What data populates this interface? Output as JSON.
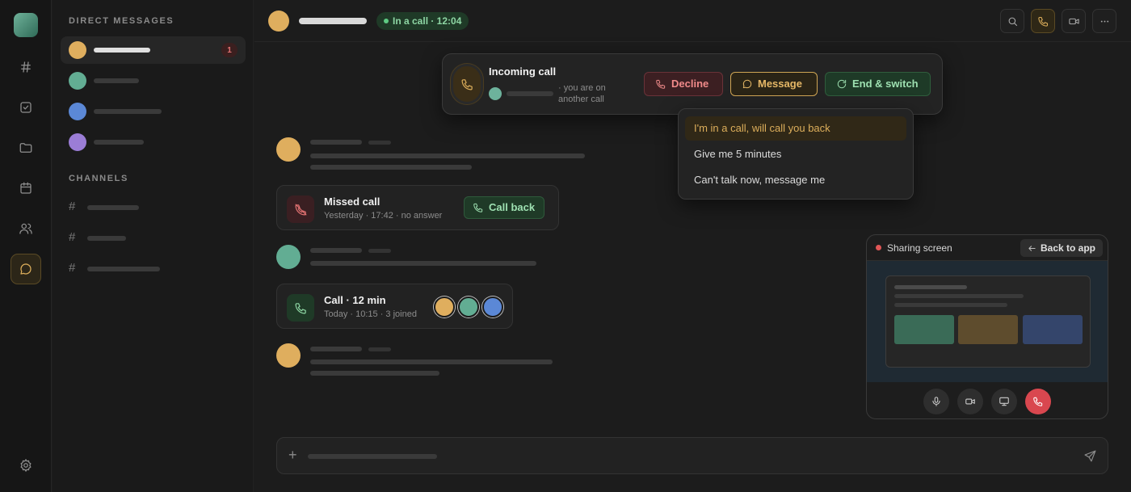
{
  "sidebar": {
    "dm_title": "DIRECT MESSAGES",
    "channels_title": "CHANNELS",
    "dms": [
      {
        "color": "#dfae5e",
        "unread": "1"
      },
      {
        "color": "#62ad93"
      },
      {
        "color": "#5b88d6"
      },
      {
        "color": "#9b7dd6"
      }
    ]
  },
  "header": {
    "call_status": "In a call · 12:04"
  },
  "incoming_call": {
    "title": "Incoming call",
    "note": "· you are on another call",
    "decline_label": "Decline",
    "message_label": "Message",
    "switch_label": "End & switch"
  },
  "quick_replies": [
    "I'm in a call, will call you back",
    "Give me 5 minutes",
    "Can't talk now, message me"
  ],
  "messages": {
    "missed_call": {
      "title": "Missed call",
      "subtitle": "Yesterday · 17:42 · no answer",
      "action_label": "Call back"
    },
    "call_summary": {
      "title": "Call · 12 min",
      "subtitle": "Today · 10:15 · 3 joined",
      "participant_colors": [
        "#dfae5e",
        "#62ad93",
        "#5b88d6"
      ]
    }
  },
  "screen_share": {
    "status": "Sharing screen",
    "back_label": "Back to app"
  },
  "colors": {
    "accent": "#dcae5b",
    "success": "#5fcb84",
    "danger": "#d9474f"
  }
}
